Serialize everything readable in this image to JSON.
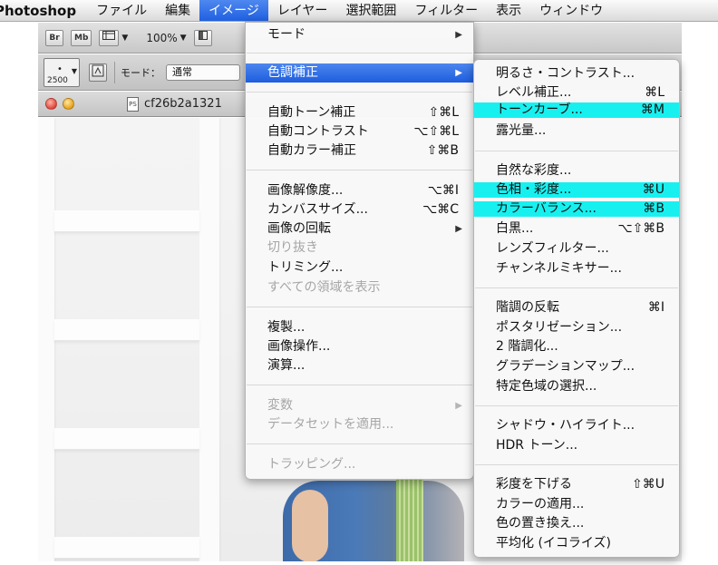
{
  "menubar": {
    "app": "Photoshop",
    "items": [
      "ファイル",
      "編集",
      "イメージ",
      "レイヤー",
      "選択範囲",
      "フィルター",
      "表示",
      "ウィンドウ"
    ]
  },
  "toolbar": {
    "br": "Br",
    "mb": "Mb",
    "zoom": "100%"
  },
  "options": {
    "brush_size": "2500",
    "mode_label": "モード：",
    "mode_value": "通常"
  },
  "document": {
    "title": "cf26b2a1321"
  },
  "image_menu": {
    "items": [
      {
        "label": "モード",
        "submenu": true
      },
      {
        "label": "色調補正",
        "submenu": true,
        "selected": true
      },
      {
        "label": "自動トーン補正",
        "shortcut": "⇧⌘L"
      },
      {
        "label": "自動コントラスト",
        "shortcut": "⌥⇧⌘L"
      },
      {
        "label": "自動カラー補正",
        "shortcut": "⇧⌘B"
      },
      {
        "label": "画像解像度...",
        "shortcut": "⌥⌘I"
      },
      {
        "label": "カンバスサイズ...",
        "shortcut": "⌥⌘C"
      },
      {
        "label": "画像の回転",
        "submenu": true
      },
      {
        "label": "切り抜き",
        "disabled": true
      },
      {
        "label": "トリミング..."
      },
      {
        "label": "すべての領域を表示",
        "disabled": true
      },
      {
        "label": "複製..."
      },
      {
        "label": "画像操作..."
      },
      {
        "label": "演算..."
      },
      {
        "label": "変数",
        "disabled": true,
        "submenu": true
      },
      {
        "label": "データセットを適用...",
        "disabled": true
      },
      {
        "label": "トラッピング...",
        "disabled": true
      }
    ]
  },
  "adjust_menu": {
    "items": [
      {
        "label": "明るさ・コントラスト..."
      },
      {
        "label": "レベル補正...",
        "shortcut": "⌘L"
      },
      {
        "label": "トーンカーブ...",
        "shortcut": "⌘M",
        "highlighted": true
      },
      {
        "label": "露光量..."
      },
      {
        "label": "自然な彩度..."
      },
      {
        "label": "色相・彩度...",
        "shortcut": "⌘U",
        "highlighted": true
      },
      {
        "label": "カラーバランス...",
        "shortcut": "⌘B",
        "highlighted": true
      },
      {
        "label": "白黒...",
        "shortcut": "⌥⇧⌘B"
      },
      {
        "label": "レンズフィルター..."
      },
      {
        "label": "チャンネルミキサー..."
      },
      {
        "label": "階調の反転",
        "shortcut": "⌘I"
      },
      {
        "label": "ポスタリゼーション..."
      },
      {
        "label": "2 階調化..."
      },
      {
        "label": "グラデーションマップ..."
      },
      {
        "label": "特定色域の選択..."
      },
      {
        "label": "シャドウ・ハイライト..."
      },
      {
        "label": "HDR トーン..."
      },
      {
        "label": "彩度を下げる",
        "shortcut": "⇧⌘U"
      },
      {
        "label": "カラーの適用..."
      },
      {
        "label": "色の置き換え..."
      },
      {
        "label": "平均化 (イコライズ)"
      }
    ]
  },
  "colors": {
    "selection": "#2f72e8",
    "highlight": "#18f0f0"
  }
}
